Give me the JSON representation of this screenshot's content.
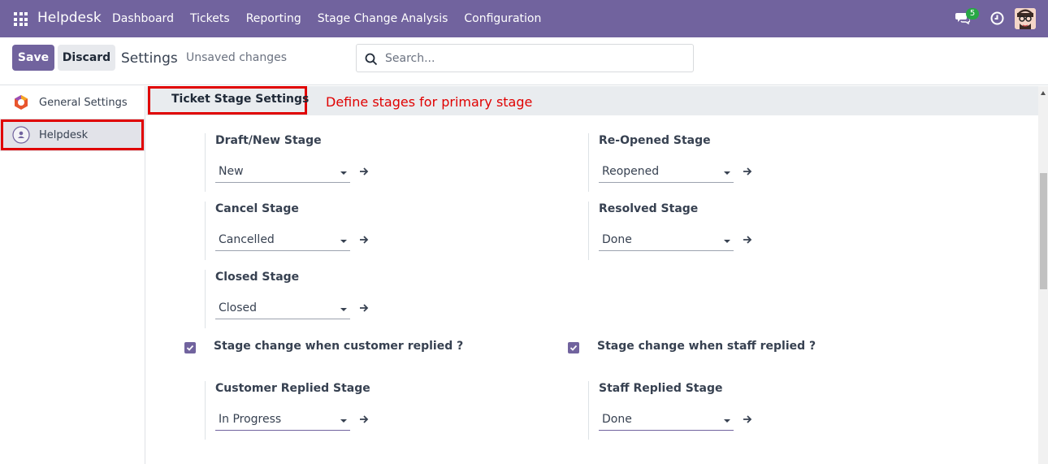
{
  "navbar": {
    "brand": "Helpdesk",
    "menu": [
      "Dashboard",
      "Tickets",
      "Reporting",
      "Stage Change Analysis",
      "Configuration"
    ],
    "chat_badge": "5",
    "color": "#71639e"
  },
  "control": {
    "save_label": "Save",
    "discard_label": "Discard",
    "title": "Settings",
    "status": "Unsaved changes",
    "search_placeholder": "Search..."
  },
  "sidebar": {
    "items": [
      {
        "label": "General Settings",
        "icon": "odoo-logo-icon"
      },
      {
        "label": "Helpdesk",
        "icon": "helpdesk-user-icon",
        "active": true
      }
    ]
  },
  "section": {
    "title": "Ticket Stage Settings",
    "note": "Define stages for primary stage"
  },
  "stages": {
    "draft": {
      "label": "Draft/New Stage",
      "value": "New"
    },
    "reopened": {
      "label": "Re-Opened Stage",
      "value": "Reopened"
    },
    "cancel": {
      "label": "Cancel Stage",
      "value": "Cancelled"
    },
    "resolved": {
      "label": "Resolved Stage",
      "value": "Done"
    },
    "closed": {
      "label": "Closed Stage",
      "value": "Closed"
    },
    "customer_replied": {
      "label": "Customer Replied Stage",
      "value": "In Progress"
    },
    "staff_replied": {
      "label": "Staff Replied Stage",
      "value": "Done"
    }
  },
  "checks": {
    "customer": {
      "label": "Stage change when customer replied ?",
      "checked": true
    },
    "staff": {
      "label": "Stage change when staff replied ?",
      "checked": true
    }
  },
  "colors": {
    "accent": "#71639e",
    "annotation_red": "#e00000",
    "badge_green": "#28a745"
  }
}
